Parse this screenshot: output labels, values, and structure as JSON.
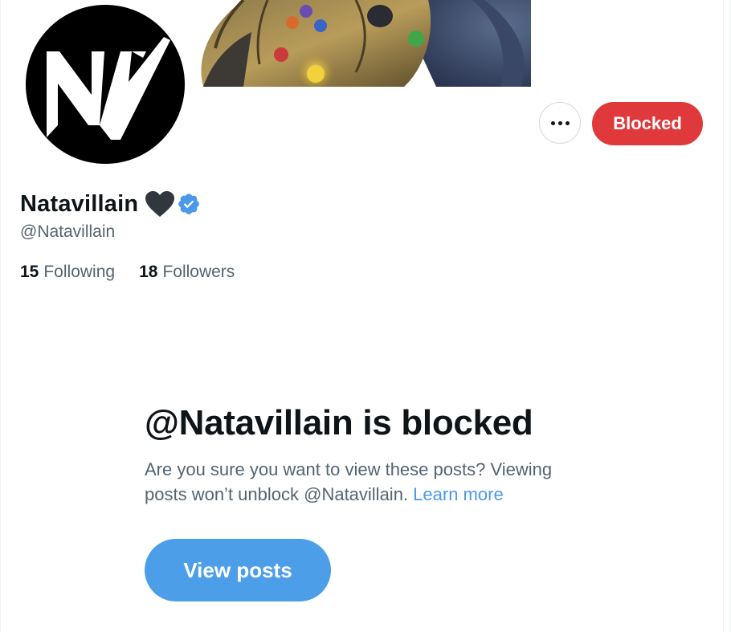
{
  "profile": {
    "display_name": "Natavillain",
    "handle": "@Natavillain",
    "following_count": "15",
    "following_label": "Following",
    "followers_count": "18",
    "followers_label": "Followers",
    "emoji_icon": "black-heart-icon",
    "verified_icon": "verified-badge-icon",
    "avatar_icon": "nv-logo-icon",
    "banner_image": "gauntlet-banner-image"
  },
  "actions": {
    "more_icon": "more-options-icon",
    "blocked_label": "Blocked"
  },
  "notice": {
    "title": "@Natavillain is blocked",
    "description": "Are you sure you want to view these posts? Viewing posts won’t unblock @Natavillain.",
    "learn_more": "Learn more",
    "view_posts_label": "View posts"
  },
  "colors": {
    "blocked_button": "#e0393b",
    "view_posts_button": "#4c9ee8",
    "link": "#4a99e9",
    "verified": "#4a99e9",
    "secondary_text": "#536471",
    "primary_text": "#0f1419"
  }
}
